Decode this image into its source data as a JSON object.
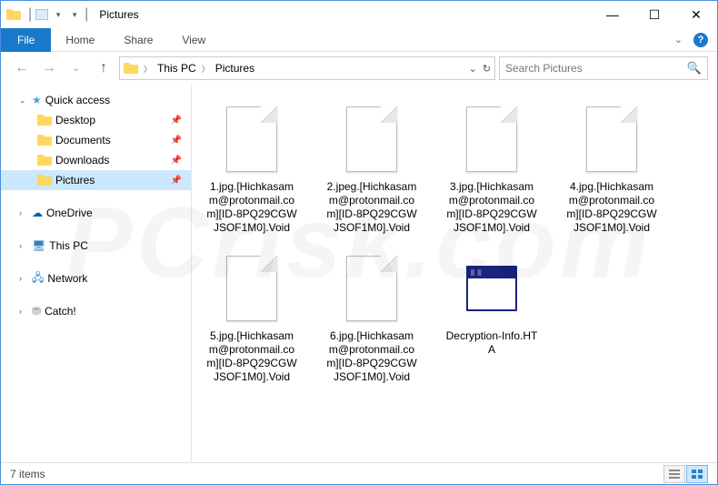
{
  "window": {
    "title": "Pictures"
  },
  "ribbon": {
    "file": "File",
    "tabs": [
      "Home",
      "Share",
      "View"
    ]
  },
  "breadcrumb": {
    "root": "This PC",
    "current": "Pictures"
  },
  "search": {
    "placeholder": "Search Pictures"
  },
  "sidebar": {
    "quick_access": "Quick access",
    "pinned": [
      {
        "label": "Desktop"
      },
      {
        "label": "Documents"
      },
      {
        "label": "Downloads"
      },
      {
        "label": "Pictures",
        "selected": true
      }
    ],
    "nodes": [
      "OneDrive",
      "This PC",
      "Network",
      "Catch!"
    ]
  },
  "files": [
    {
      "name": "1.jpg.[Hichkasamm@protonmail.com][ID-8PQ29CGWJSOF1M0].Void",
      "type": "blank"
    },
    {
      "name": "2.jpeg.[Hichkasamm@protonmail.com][ID-8PQ29CGWJSOF1M0].Void",
      "type": "blank"
    },
    {
      "name": "3.jpg.[Hichkasamm@protonmail.com][ID-8PQ29CGWJSOF1M0].Void",
      "type": "blank"
    },
    {
      "name": "4.jpg.[Hichkasamm@protonmail.com][ID-8PQ29CGWJSOF1M0].Void",
      "type": "blank"
    },
    {
      "name": "5.jpg.[Hichkasamm@protonmail.com][ID-8PQ29CGWJSOF1M0].Void",
      "type": "blank"
    },
    {
      "name": "6.jpg.[Hichkasamm@protonmail.com][ID-8PQ29CGWJSOF1M0].Void",
      "type": "blank"
    },
    {
      "name": "Decryption-Info.HTA",
      "type": "hta"
    }
  ],
  "status": {
    "count_text": "7 items"
  },
  "watermark": "PCrisk.com"
}
